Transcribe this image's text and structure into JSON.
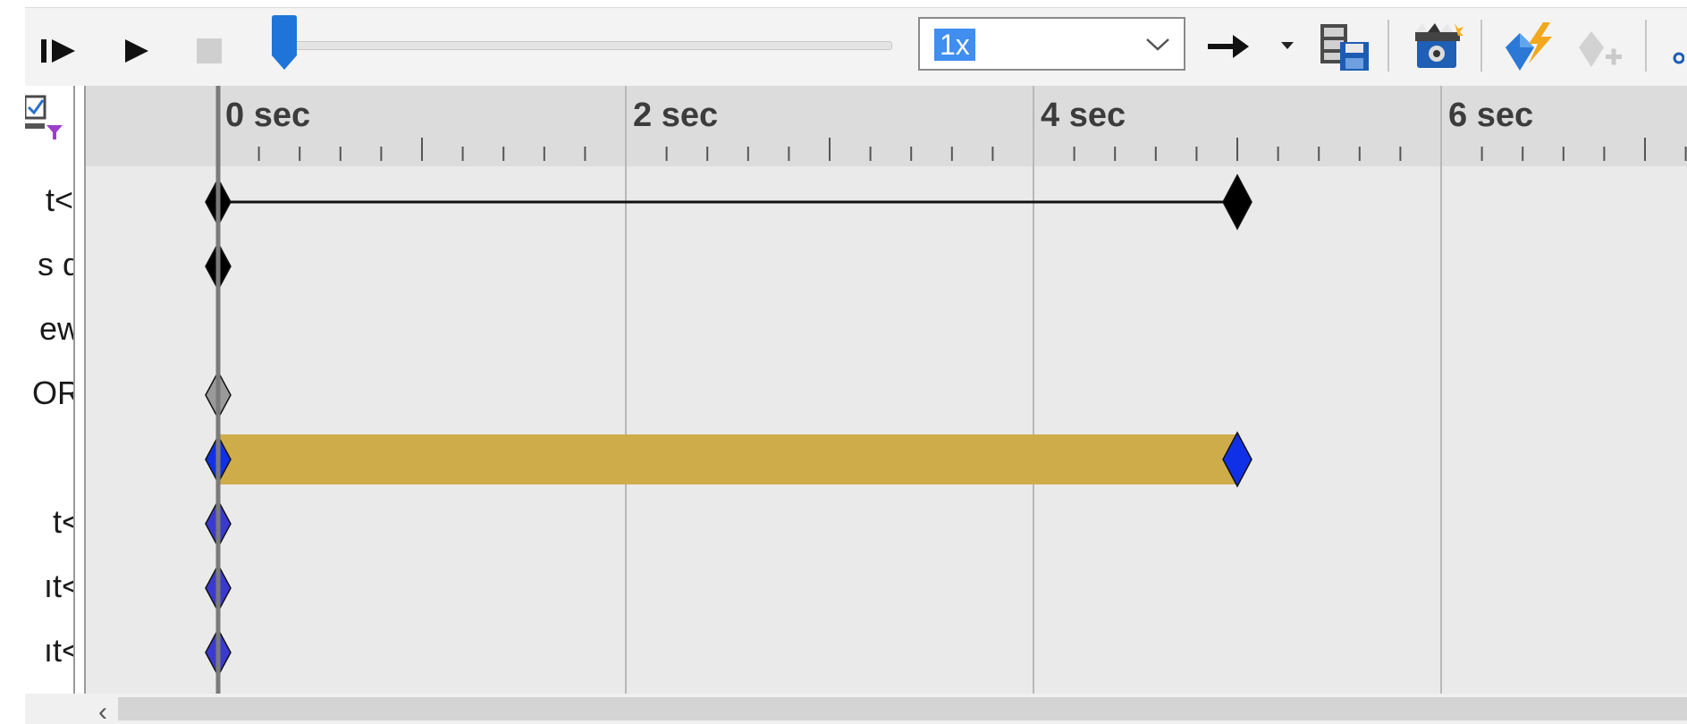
{
  "toolbar": {
    "speed": {
      "value": "1x",
      "selected": true
    },
    "icons": [
      "step-play-icon",
      "play-icon",
      "stop-icon",
      "arrow-right-icon",
      "dropdown-caret-icon",
      "save-animation-icon",
      "camera-icon",
      "key-lightning-icon",
      "add-key-icon"
    ]
  },
  "timeline": {
    "time_labels": [
      "0 sec",
      "2 sec",
      "4 sec",
      "6 sec"
    ],
    "time_label_seconds": [
      0,
      2,
      4,
      6
    ],
    "playhead_seconds": 0,
    "rows": [
      {
        "label": "t<l",
        "keys_seconds": [
          0,
          5
        ],
        "key_color": "#000000",
        "style": "line"
      },
      {
        "label": "s d",
        "keys_seconds": [
          0
        ],
        "key_color": "#000000",
        "style": "key"
      },
      {
        "label": "ew",
        "keys_seconds": [],
        "key_color": "#000000",
        "style": "none"
      },
      {
        "label": "OR",
        "keys_seconds": [
          0
        ],
        "key_color": "#9a9a9a",
        "style": "key"
      },
      {
        "label": "",
        "keys_seconds": [
          0,
          5
        ],
        "key_color": "#1030e8",
        "style": "bar",
        "bar_color": "#cfac4a"
      },
      {
        "label": "t<",
        "keys_seconds": [
          0
        ],
        "key_color": "#3a3ad0",
        "style": "key"
      },
      {
        "label": "ıt<",
        "keys_seconds": [
          0
        ],
        "key_color": "#3a3ad0",
        "style": "key"
      },
      {
        "label": "ıt<",
        "keys_seconds": [
          0
        ],
        "key_color": "#3a3ad0",
        "style": "key"
      }
    ]
  },
  "colors": {
    "accent": "#3f8ef0",
    "slider_thumb": "#1e74d8",
    "bar": "#cfac4a"
  }
}
